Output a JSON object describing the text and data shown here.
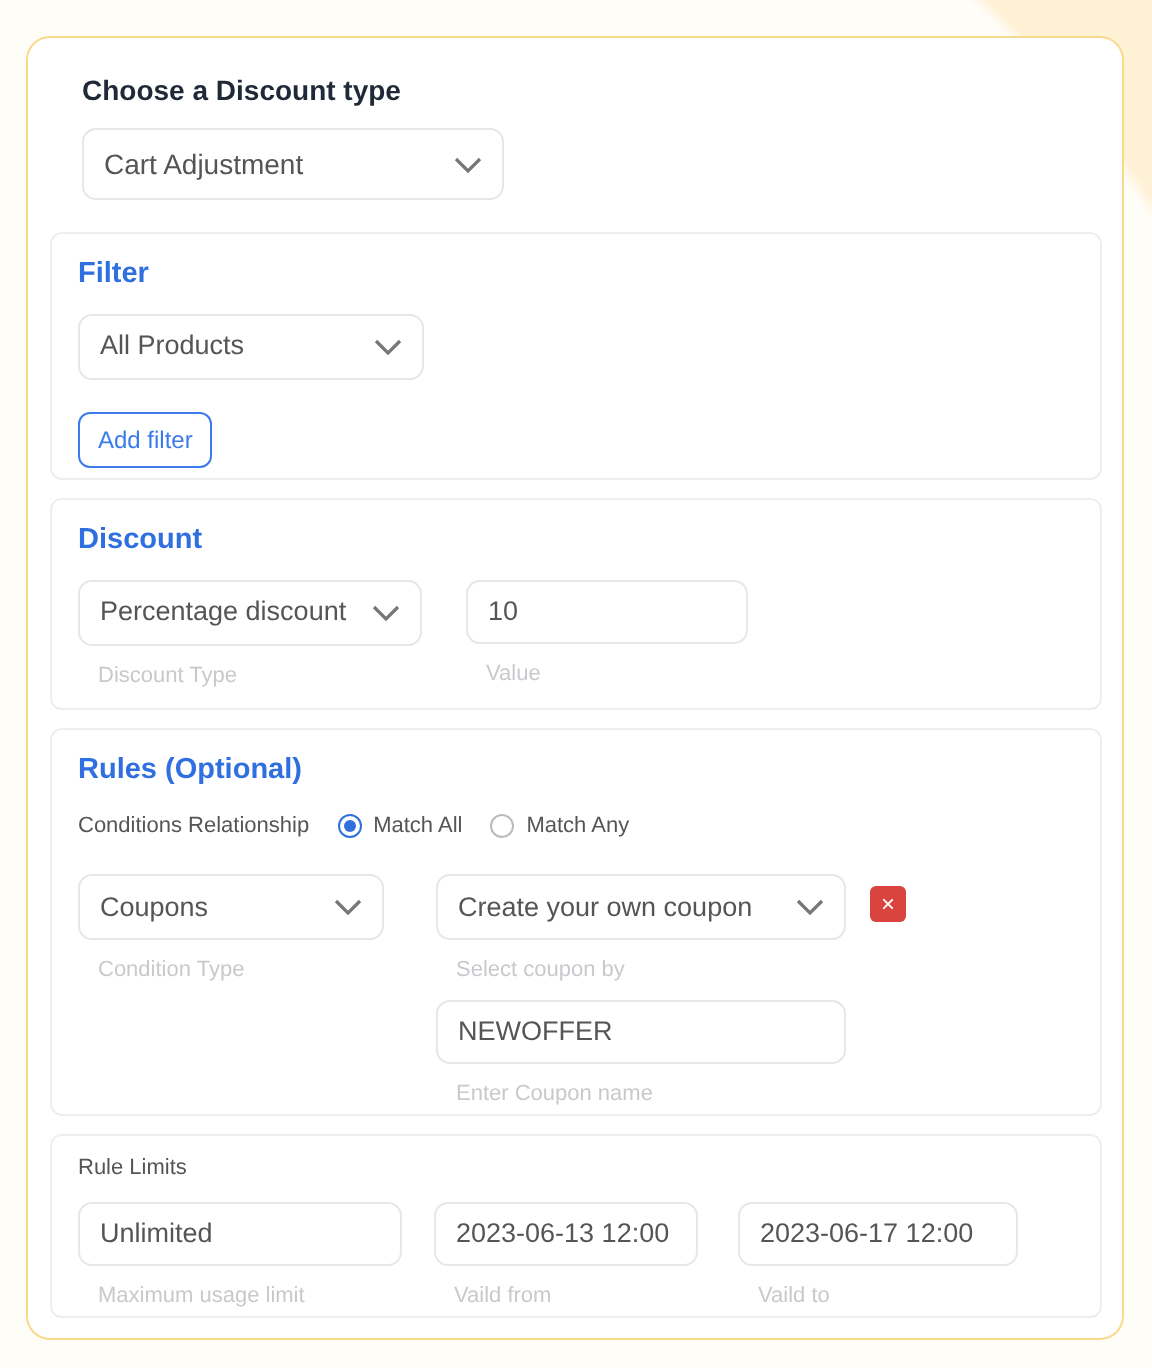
{
  "discount_type": {
    "label": "Choose a Discount type",
    "value": "Cart Adjustment"
  },
  "filter": {
    "title": "Filter",
    "select": "All Products",
    "button": "Add filter"
  },
  "discount": {
    "title": "Discount",
    "fields": [
      {
        "kind": "select",
        "value": "Percentage discount",
        "helper": "Discount Type"
      },
      {
        "kind": "input",
        "value": "10",
        "helper": "Value"
      }
    ]
  },
  "rules": {
    "title": "Rules (Optional)",
    "relationship_label": "Conditions Relationship",
    "options": [
      {
        "label": "Match All",
        "selected": true
      },
      {
        "label": "Match Any",
        "selected": false
      }
    ],
    "condition": {
      "kind": "select",
      "value": "Coupons",
      "helper": "Condition Type"
    },
    "coupon_by": {
      "kind": "select",
      "value": "Create your own coupon",
      "helper": "Select coupon by"
    },
    "coupon_name": {
      "kind": "input",
      "value": "NEWOFFER",
      "helper": "Enter Coupon name"
    },
    "remove_button": "×"
  },
  "rule_limits": {
    "title": "Rule Limits",
    "fields": [
      {
        "kind": "input",
        "value": "Unlimited",
        "helper": "Maximum usage limit"
      },
      {
        "kind": "input",
        "value": "2023-06-13 12:00",
        "helper": "Vaild from"
      },
      {
        "kind": "input",
        "value": "2023-06-17 12:00",
        "helper": "Vaild to"
      }
    ]
  }
}
